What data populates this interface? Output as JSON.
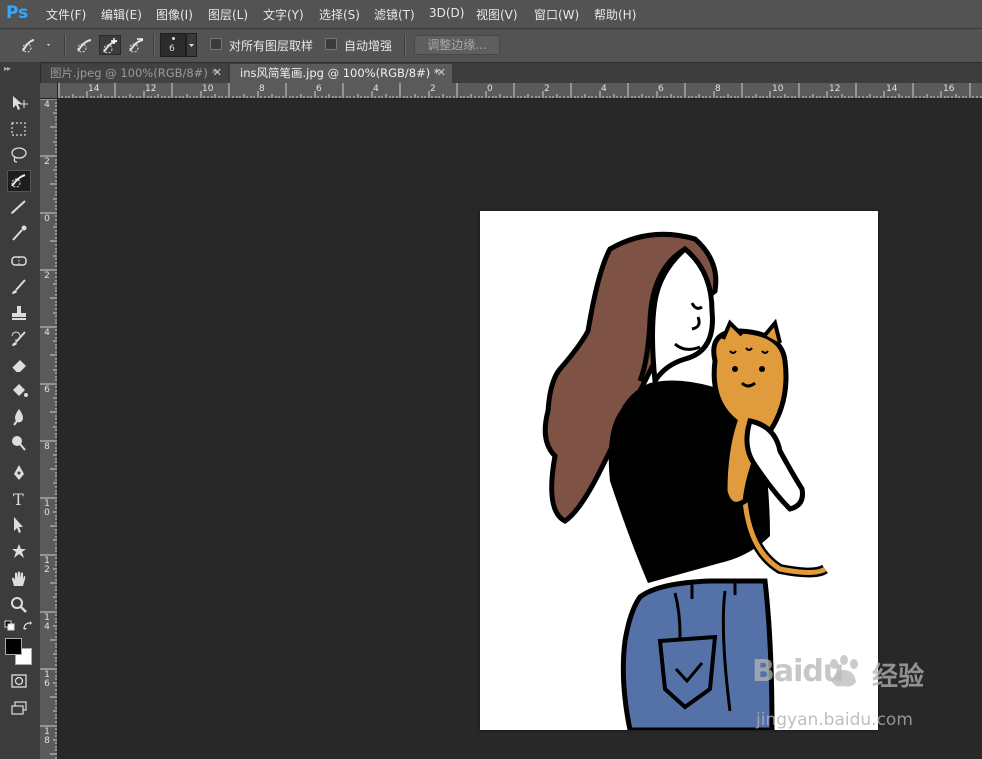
{
  "app": {
    "logo": "Ps"
  },
  "menu": [
    "文件(F)",
    "编辑(E)",
    "图像(I)",
    "图层(L)",
    "文字(Y)",
    "选择(S)",
    "滤镜(T)",
    "3D(D)",
    "视图(V)",
    "窗口(W)",
    "帮助(H)"
  ],
  "options": {
    "brush_size": "6",
    "sample_all_layers_label": "对所有图层取样",
    "sample_all_layers_checked": false,
    "auto_enhance_label": "自动增强",
    "auto_enhance_checked": false,
    "refine_edge_label": "调整边缘..."
  },
  "tabs": [
    {
      "title": "图片.jpeg @ 100%(RGB/8#) *",
      "active": false
    },
    {
      "title": "ins风简笔画.jpg @ 100%(RGB/8#) *",
      "active": true
    }
  ],
  "ruler_top_labels": [
    "14",
    "12",
    "10",
    "8",
    "6",
    "4",
    "2",
    "0",
    "2",
    "4",
    "6",
    "8",
    "10",
    "12",
    "14",
    "16"
  ],
  "ruler_left_labels": [
    "4",
    "2",
    "0",
    "2",
    "4",
    "6",
    "8",
    "1\n0",
    "1\n2",
    "1\n4",
    "1\n6",
    "1\n8"
  ],
  "tools": [
    "move-tool-icon",
    "marquee-tool-icon",
    "lasso-tool-icon",
    "quick-selection-tool-icon",
    "crop-tool-icon",
    "eyedropper-tool-icon",
    "healing-brush-tool-icon",
    "brush-tool-icon",
    "clone-stamp-tool-icon",
    "history-brush-tool-icon",
    "eraser-tool-icon",
    "paint-bucket-tool-icon",
    "blur-tool-icon",
    "dodge-tool-icon",
    "pen-tool-icon",
    "type-tool-icon",
    "path-selection-tool-icon",
    "custom-shape-tool-icon",
    "hand-tool-icon",
    "zoom-tool-icon"
  ],
  "colors": {
    "foreground": "#000000",
    "background": "#ffffff"
  },
  "watermark": {
    "brand": "Baidu",
    "cn": "经验",
    "url": "jingyan.baidu.com"
  }
}
